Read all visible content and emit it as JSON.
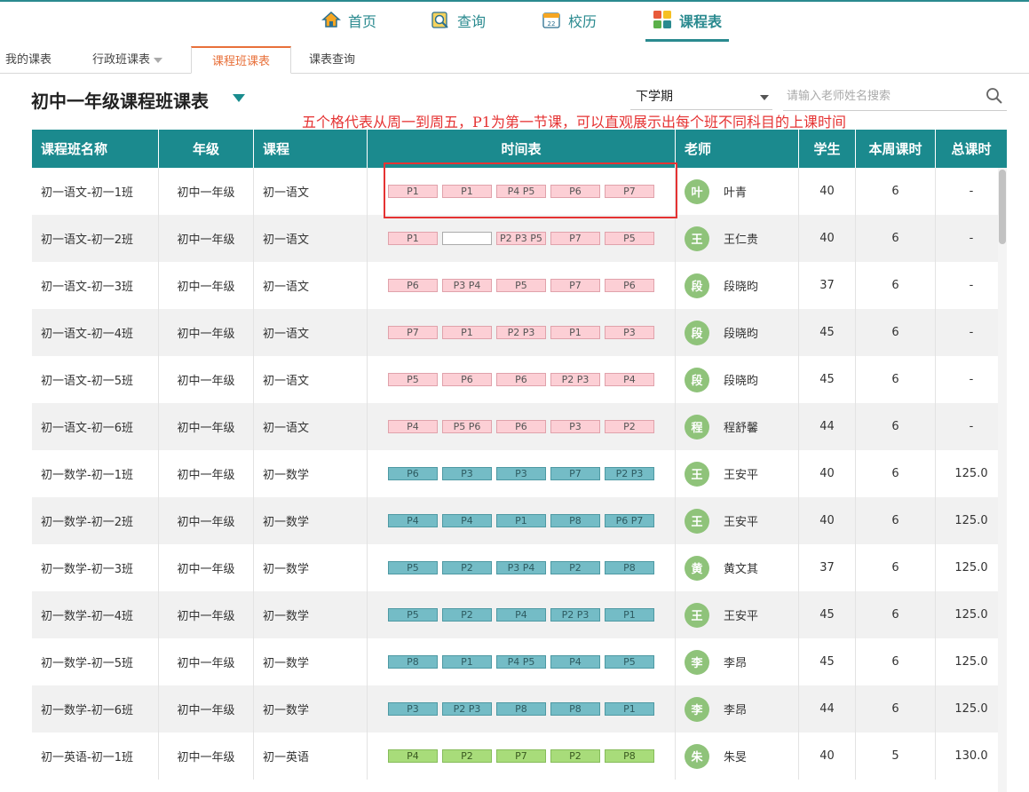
{
  "nav": {
    "items": [
      {
        "label": "首页",
        "icon": "home-icon"
      },
      {
        "label": "查询",
        "icon": "search-doc-icon"
      },
      {
        "label": "校历",
        "icon": "calendar-icon"
      },
      {
        "label": "课程表",
        "icon": "schedule-icon",
        "active": true
      }
    ]
  },
  "subtabs": {
    "my": "我的课表",
    "admin_class": "行政班课表",
    "course_class": "课程班课表",
    "query": "课表查询"
  },
  "page": {
    "title": "初中一年级课程班课表",
    "term": "下学期",
    "search_placeholder": "请输入老师姓名搜索",
    "annotation": "五个格代表从周一到周五，P1为第一节课，可以直观展示出每个班不同科目的上课时间"
  },
  "table": {
    "headers": [
      "课程班名称",
      "年级",
      "课程",
      "时间表",
      "老师",
      "学生",
      "本周课时",
      "总课时"
    ],
    "rows": [
      {
        "name": "初一语文-初一1班",
        "grade": "初中一年级",
        "course": "初一语文",
        "subject": "zh",
        "slots": [
          "P1",
          "P1",
          "P4 P5",
          "P6",
          "P7"
        ],
        "teacher": "叶青",
        "avatar": "叶",
        "students": "40",
        "week": "6",
        "total": "-"
      },
      {
        "name": "初一语文-初一2班",
        "grade": "初中一年级",
        "course": "初一语文",
        "subject": "zh",
        "slots": [
          "P1",
          "",
          "P2 P3 P5",
          "P7",
          "P5"
        ],
        "teacher": "王仁贵",
        "avatar": "王",
        "students": "40",
        "week": "6",
        "total": "-"
      },
      {
        "name": "初一语文-初一3班",
        "grade": "初中一年级",
        "course": "初一语文",
        "subject": "zh",
        "slots": [
          "P6",
          "P3 P4",
          "P5",
          "P7",
          "P6"
        ],
        "teacher": "段晓昀",
        "avatar": "段",
        "students": "37",
        "week": "6",
        "total": "-"
      },
      {
        "name": "初一语文-初一4班",
        "grade": "初中一年级",
        "course": "初一语文",
        "subject": "zh",
        "slots": [
          "P7",
          "P1",
          "P2 P3",
          "P1",
          "P3"
        ],
        "teacher": "段晓昀",
        "avatar": "段",
        "students": "45",
        "week": "6",
        "total": "-"
      },
      {
        "name": "初一语文-初一5班",
        "grade": "初中一年级",
        "course": "初一语文",
        "subject": "zh",
        "slots": [
          "P5",
          "P6",
          "P6",
          "P2 P3",
          "P4"
        ],
        "teacher": "段晓昀",
        "avatar": "段",
        "students": "45",
        "week": "6",
        "total": "-"
      },
      {
        "name": "初一语文-初一6班",
        "grade": "初中一年级",
        "course": "初一语文",
        "subject": "zh",
        "slots": [
          "P4",
          "P5 P6",
          "P6",
          "P3",
          "P2"
        ],
        "teacher": "程舒馨",
        "avatar": "程",
        "students": "44",
        "week": "6",
        "total": "-"
      },
      {
        "name": "初一数学-初一1班",
        "grade": "初中一年级",
        "course": "初一数学",
        "subject": "ma",
        "slots": [
          "P6",
          "P3",
          "P3",
          "P7",
          "P2 P3"
        ],
        "teacher": "王安平",
        "avatar": "王",
        "students": "40",
        "week": "6",
        "total": "125.0"
      },
      {
        "name": "初一数学-初一2班",
        "grade": "初中一年级",
        "course": "初一数学",
        "subject": "ma",
        "slots": [
          "P4",
          "P4",
          "P1",
          "P8",
          "P6 P7"
        ],
        "teacher": "王安平",
        "avatar": "王",
        "students": "40",
        "week": "6",
        "total": "125.0"
      },
      {
        "name": "初一数学-初一3班",
        "grade": "初中一年级",
        "course": "初一数学",
        "subject": "ma",
        "slots": [
          "P5",
          "P2",
          "P3 P4",
          "P2",
          "P8"
        ],
        "teacher": "黄文其",
        "avatar": "黄",
        "students": "37",
        "week": "6",
        "total": "125.0"
      },
      {
        "name": "初一数学-初一4班",
        "grade": "初中一年级",
        "course": "初一数学",
        "subject": "ma",
        "slots": [
          "P5",
          "P2",
          "P4",
          "P2 P3",
          "P1"
        ],
        "teacher": "王安平",
        "avatar": "王",
        "students": "45",
        "week": "6",
        "total": "125.0"
      },
      {
        "name": "初一数学-初一5班",
        "grade": "初中一年级",
        "course": "初一数学",
        "subject": "ma",
        "slots": [
          "P8",
          "P1",
          "P4 P5",
          "P4",
          "P5"
        ],
        "teacher": "李昂",
        "avatar": "李",
        "students": "45",
        "week": "6",
        "total": "125.0"
      },
      {
        "name": "初一数学-初一6班",
        "grade": "初中一年级",
        "course": "初一数学",
        "subject": "ma",
        "slots": [
          "P3",
          "P2 P3",
          "P8",
          "P8",
          "P1"
        ],
        "teacher": "李昂",
        "avatar": "李",
        "students": "44",
        "week": "6",
        "total": "125.0"
      },
      {
        "name": "初一英语-初一1班",
        "grade": "初中一年级",
        "course": "初一英语",
        "subject": "en",
        "slots": [
          "P4",
          "P2",
          "P7",
          "P2",
          "P8"
        ],
        "teacher": "朱旻",
        "avatar": "朱",
        "students": "40",
        "week": "5",
        "total": "130.0"
      }
    ]
  },
  "colors": {
    "brand": "#1b8a8e",
    "active_tab": "#e8703a",
    "annotation": "#e53333",
    "chinese_slot": "#fccfd5",
    "math_slot": "#74bcc6",
    "english_slot": "#a8dc7a",
    "avatar": "#8fc37a"
  }
}
